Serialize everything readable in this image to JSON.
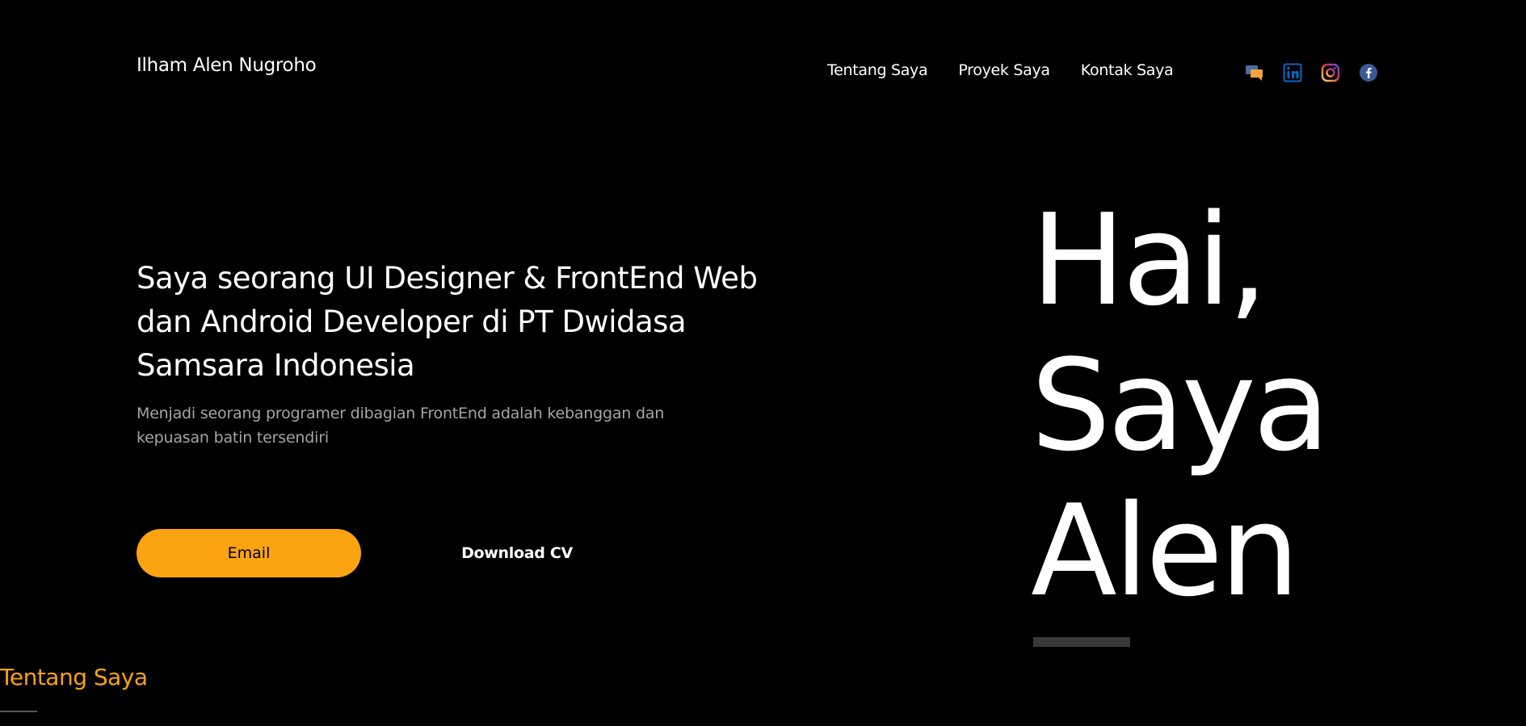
{
  "brand": "Ilham Alen Nugroho",
  "nav": {
    "items": [
      "Tentang Saya",
      "Proyek Saya",
      "Kontak Saya"
    ]
  },
  "socials": [
    "chat-icon",
    "linkedin-icon",
    "instagram-icon",
    "facebook-icon"
  ],
  "hero": {
    "headline": "Saya seorang UI Designer & FrontEnd Web dan Android Developer di PT Dwidasa Samsara Indonesia",
    "subtext": "Menjadi seorang programer dibagian FrontEnd adalah kebanggan dan kepuasan batin tersendiri",
    "email_button": "Email",
    "cv_button": "Download CV",
    "big_lines": [
      "Hai,",
      "Saya",
      "Alen"
    ]
  },
  "section": {
    "title": "Tentang Saya"
  },
  "colors": {
    "background": "#000000",
    "accent": "#fca311",
    "text": "#ffffff",
    "muted": "#a5a5a5",
    "linkedin": "#0a66c2",
    "facebook": "#3b5998"
  }
}
